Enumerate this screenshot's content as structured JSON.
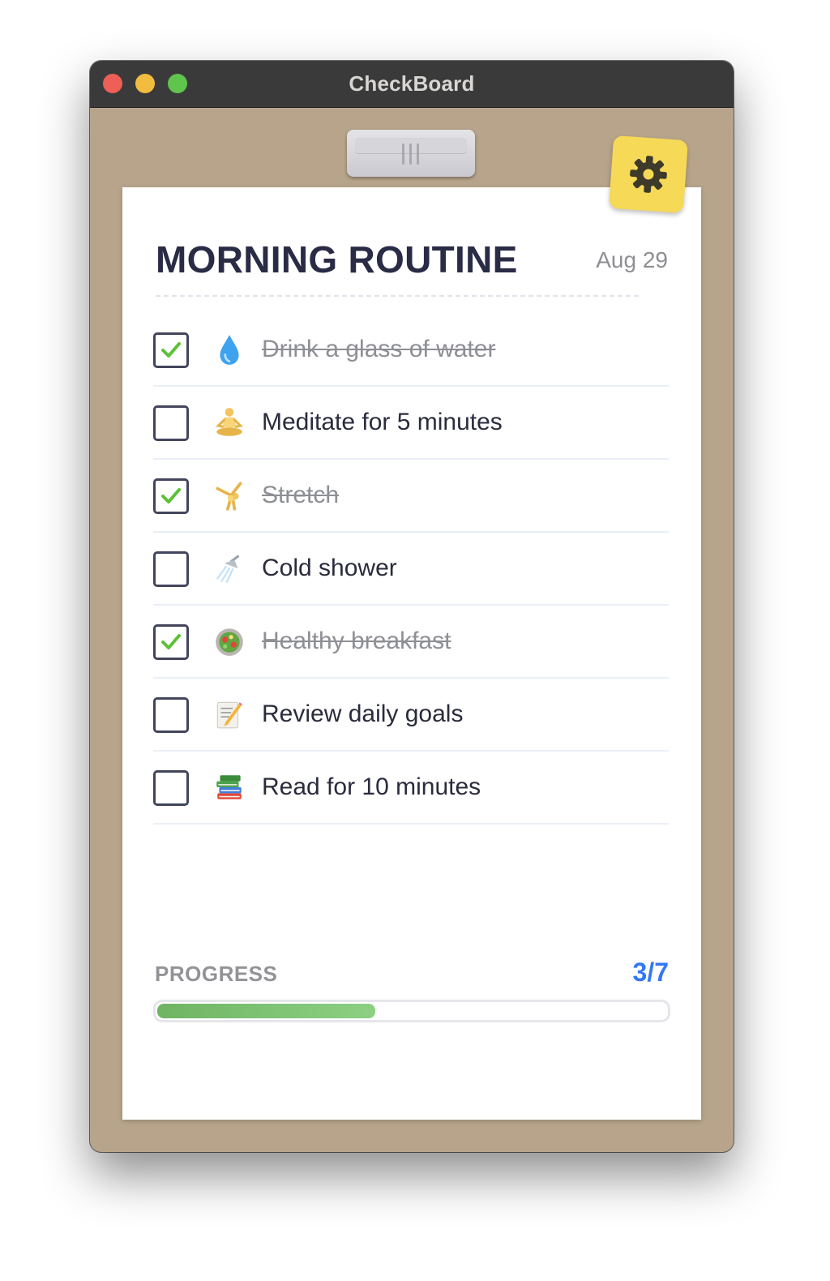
{
  "window": {
    "title": "CheckBoard"
  },
  "header": {
    "title": "MORNING ROUTINE",
    "date": "Aug 29",
    "settings_icon": "gear-icon"
  },
  "tasks": [
    {
      "label": "Drink a glass of water",
      "done": true,
      "icon": "water-drop-icon"
    },
    {
      "label": "Meditate for 5 minutes",
      "done": false,
      "icon": "meditation-icon"
    },
    {
      "label": "Stretch",
      "done": true,
      "icon": "cartwheel-icon"
    },
    {
      "label": "Cold shower",
      "done": false,
      "icon": "shower-icon"
    },
    {
      "label": "Healthy breakfast",
      "done": true,
      "icon": "salad-icon"
    },
    {
      "label": "Review daily goals",
      "done": false,
      "icon": "memo-icon"
    },
    {
      "label": "Read for 10 minutes",
      "done": false,
      "icon": "books-icon"
    }
  ],
  "progress": {
    "label": "PROGRESS",
    "count_text": "3/7",
    "completed": 3,
    "total": 7
  },
  "colors": {
    "corkboard": "#b7a48b",
    "title_text": "#2a2b45",
    "accent_blue": "#3478f6",
    "check_green": "#5bc236",
    "gear_button": "#f6d957",
    "progress_fill": "#7cc071"
  }
}
